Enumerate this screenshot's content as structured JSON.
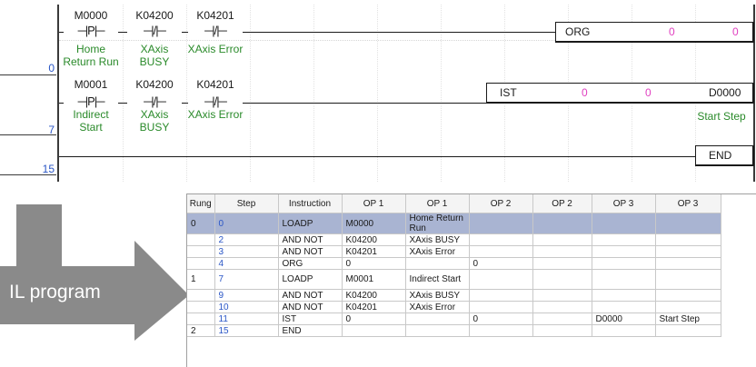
{
  "ladder": {
    "rungs": [
      {
        "rung_number": "0",
        "contacts": [
          {
            "device": "M0000",
            "symbol": "─|P|─",
            "comment": "Home Return Run",
            "icon": "positive-pulse-contact-icon"
          },
          {
            "device": "K04200",
            "symbol": "─|/|─",
            "comment": "XAxis BUSY",
            "icon": "normally-closed-contact-icon"
          },
          {
            "device": "K04201",
            "symbol": "─|/|─",
            "comment": "XAxis Error",
            "icon": "normally-closed-contact-icon"
          }
        ],
        "function": {
          "name": "ORG",
          "op1": "0",
          "op2": "0"
        }
      },
      {
        "rung_number": "7",
        "contacts": [
          {
            "device": "M0001",
            "symbol": "─|P|─",
            "comment": "Indirect Start",
            "icon": "positive-pulse-contact-icon"
          },
          {
            "device": "K04200",
            "symbol": "─|/|─",
            "comment": "XAxis BUSY",
            "icon": "normally-closed-contact-icon"
          },
          {
            "device": "K04201",
            "symbol": "─|/|─",
            "comment": "XAxis Error",
            "icon": "normally-closed-contact-icon"
          }
        ],
        "function": {
          "name": "IST",
          "op1": "0",
          "op2": "0",
          "op3": "D0000",
          "op3_comment": "Start Step"
        }
      },
      {
        "rung_number": "15",
        "function": {
          "name": "END"
        }
      }
    ]
  },
  "arrow": {
    "label": "IL program",
    "color": "#8a8a8a"
  },
  "il_table": {
    "headers": [
      "Rung",
      "Step",
      "Instruction",
      "OP 1",
      "OP 1",
      "OP 2",
      "OP 2",
      "OP 3",
      "OP 3"
    ],
    "rows": [
      {
        "rung": "0",
        "step": "0",
        "instruction": "LOADP",
        "op1": "M0000",
        "op1_comment": "Home Return Run",
        "op2": "",
        "op2_comment": "",
        "op3": "",
        "op3_comment": ""
      },
      {
        "rung": "",
        "step": "2",
        "instruction": "AND NOT",
        "op1": "K04200",
        "op1_comment": "XAxis BUSY",
        "op2": "",
        "op2_comment": "",
        "op3": "",
        "op3_comment": ""
      },
      {
        "rung": "",
        "step": "3",
        "instruction": "AND NOT",
        "op1": "K04201",
        "op1_comment": "XAxis Error",
        "op2": "",
        "op2_comment": "",
        "op3": "",
        "op3_comment": ""
      },
      {
        "rung": "",
        "step": "4",
        "instruction": "ORG",
        "op1": "0",
        "op1_comment": "",
        "op2": "0",
        "op2_comment": "",
        "op3": "",
        "op3_comment": ""
      },
      {
        "rung": "1",
        "step": "7",
        "instruction": "LOADP",
        "op1": "M0001",
        "op1_comment": "Indirect Start",
        "op2": "",
        "op2_comment": "",
        "op3": "",
        "op3_comment": ""
      },
      {
        "rung": "",
        "step": "9",
        "instruction": "AND NOT",
        "op1": "K04200",
        "op1_comment": "XAxis BUSY",
        "op2": "",
        "op2_comment": "",
        "op3": "",
        "op3_comment": ""
      },
      {
        "rung": "",
        "step": "10",
        "instruction": "AND NOT",
        "op1": "K04201",
        "op1_comment": "XAxis Error",
        "op2": "",
        "op2_comment": "",
        "op3": "",
        "op3_comment": ""
      },
      {
        "rung": "",
        "step": "11",
        "instruction": "IST",
        "op1": "0",
        "op1_comment": "",
        "op2": "0",
        "op2_comment": "",
        "op3": "D0000",
        "op3_comment": "Start Step"
      },
      {
        "rung": "2",
        "step": "15",
        "instruction": "END",
        "op1": "",
        "op1_comment": "",
        "op2": "",
        "op2_comment": "",
        "op3": "",
        "op3_comment": ""
      }
    ],
    "selected_row_color": "#a9b4d2"
  },
  "colors": {
    "comment": "#2a8a2a",
    "rung_number": "#2a56c6",
    "constant": "#e040c0",
    "step": "#2a56c6"
  }
}
